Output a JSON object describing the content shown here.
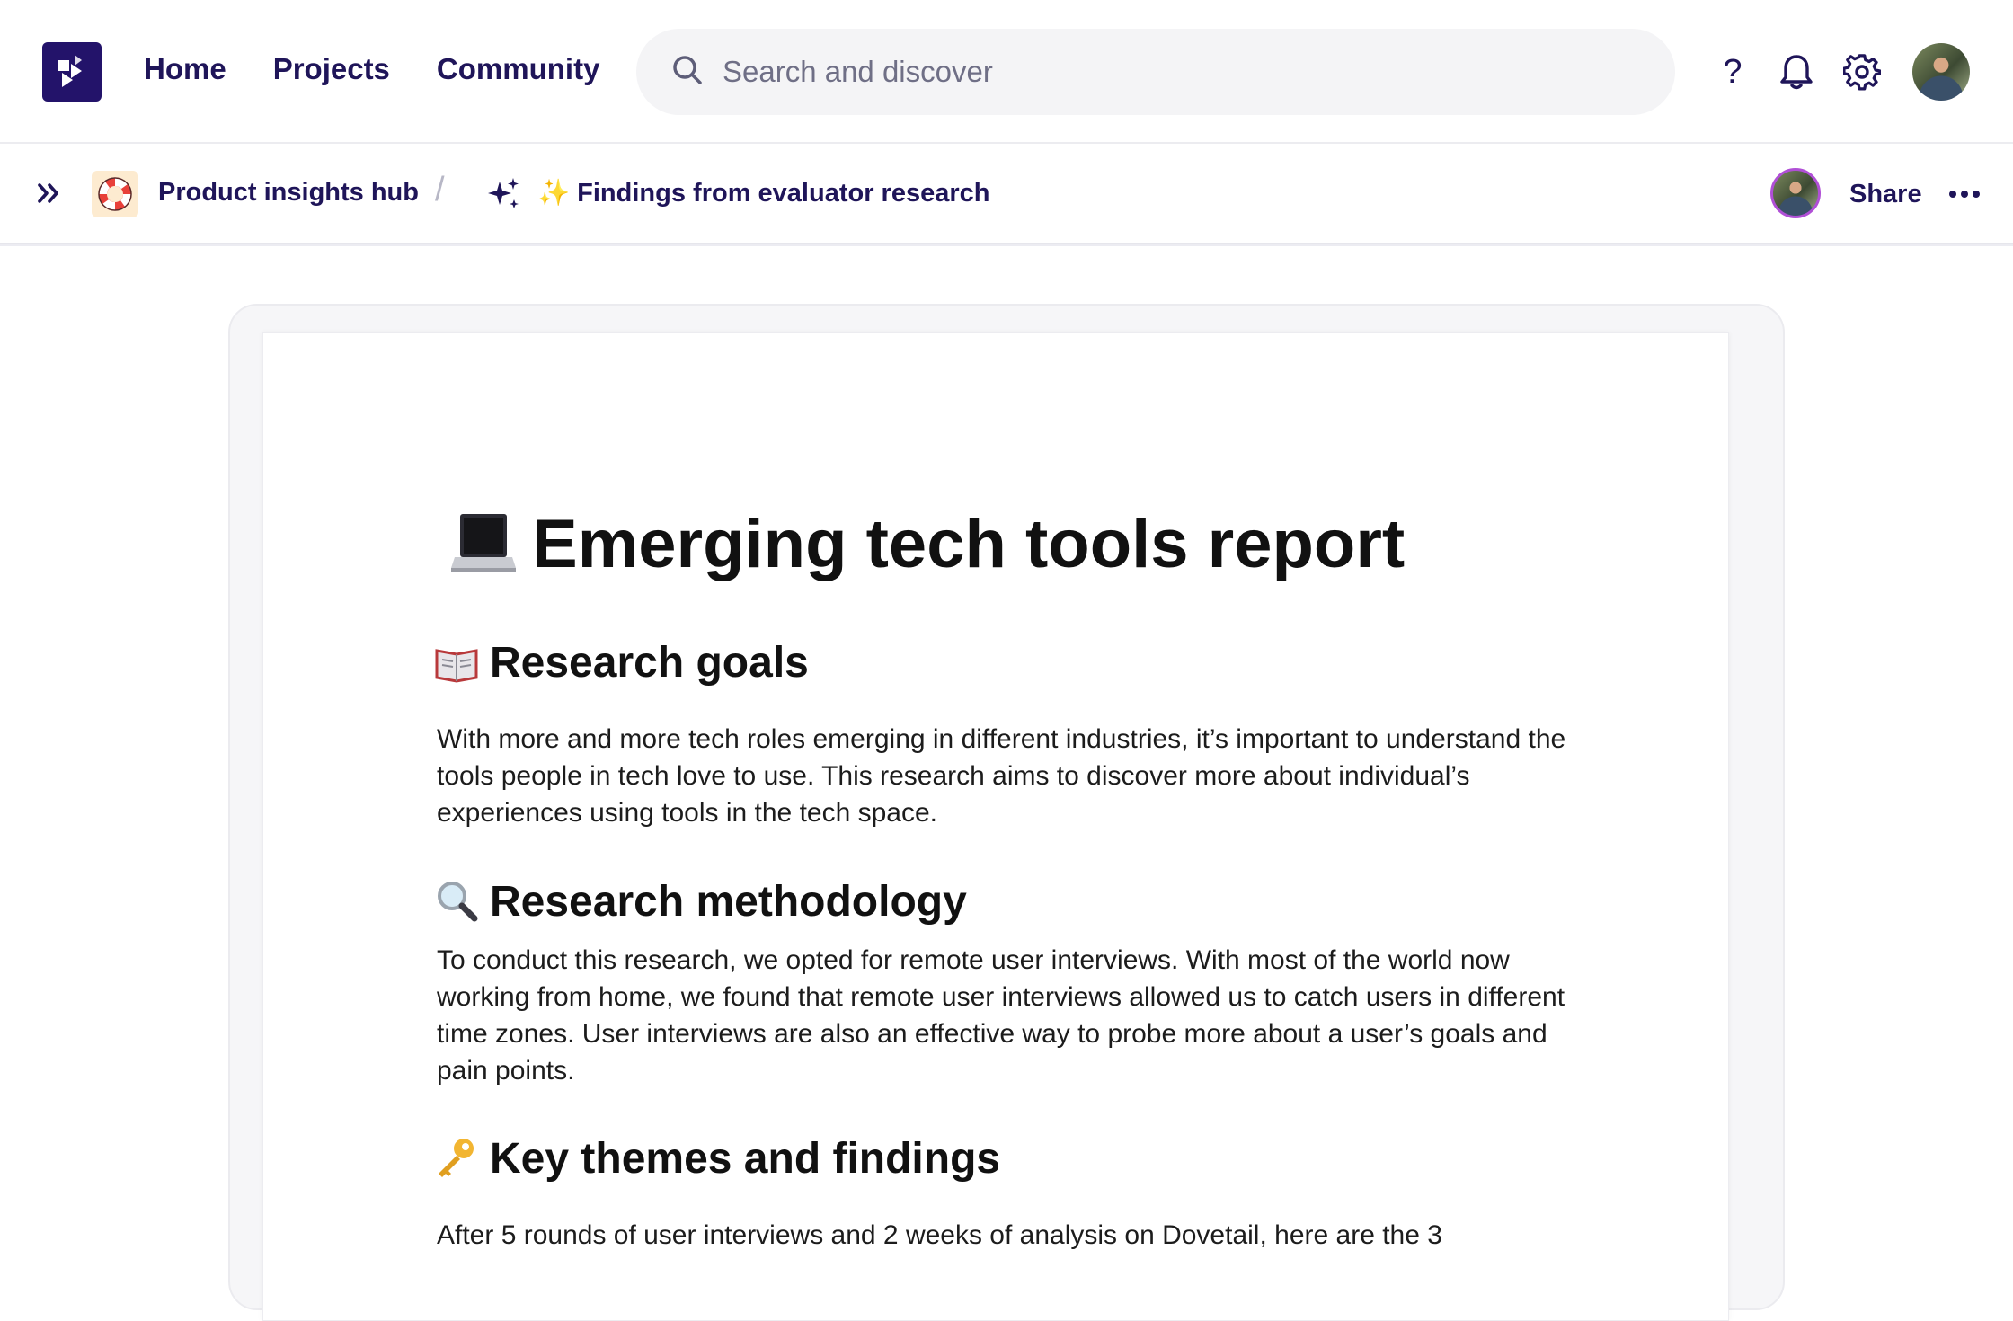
{
  "nav": {
    "links": [
      "Home",
      "Projects",
      "Community"
    ],
    "search_placeholder": "Search and discover",
    "help_label": "?"
  },
  "breadcrumb": {
    "hub": "Product insights hub",
    "separator": "/",
    "page": "✨ Findings from evaluator research",
    "share_label": "Share"
  },
  "document": {
    "title": "Emerging tech tools report",
    "sections": [
      {
        "heading": "Research goals",
        "body": "With more and more tech roles emerging in different industries, it’s important to understand the tools people in tech love to use. This research aims to discover more about individual’s experiences using tools in the tech space."
      },
      {
        "heading": "Research methodology",
        "body": "To conduct this research, we opted for remote user interviews. With most of the world now working from home, we found that remote user interviews allowed us to catch users in different time zones. User interviews are also an effective way to probe more about a user’s goals and pain points."
      },
      {
        "heading": "Key themes and findings",
        "body": "After 5 rounds of user interviews and 2 weeks of analysis on Dovetail, here are the 3"
      }
    ]
  },
  "icons": {
    "logo": "dovetail-logo-icon",
    "search": "search-icon",
    "bell": "bell-icon",
    "gear": "gear-icon",
    "expand": "chevrons-right-icon",
    "hub": "lifebuoy-icon",
    "sparkle": "sparkles-icon",
    "more": "more-horizontal-icon"
  },
  "colors": {
    "brand": "#23136a",
    "nav_text": "#1f1559",
    "search_bg": "#f4f4f6"
  }
}
